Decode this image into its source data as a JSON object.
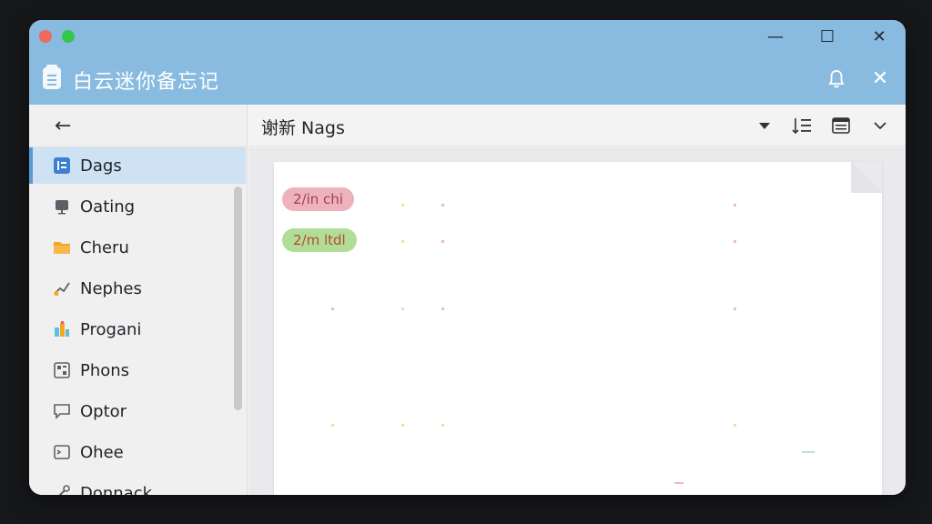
{
  "app": {
    "title": "白云迷你备忘记"
  },
  "window_controls": {
    "minimize": "—",
    "maximize": "☐",
    "close": "✕"
  },
  "sidebar": {
    "items": [
      {
        "label": "Dags",
        "icon": "list-icon",
        "active": true
      },
      {
        "label": "Oating",
        "icon": "monitor-icon"
      },
      {
        "label": "Cheru",
        "icon": "folder-icon"
      },
      {
        "label": "Nephes",
        "icon": "chart-icon"
      },
      {
        "label": "Progani",
        "icon": "bars-icon"
      },
      {
        "label": "Phons",
        "icon": "grid-icon"
      },
      {
        "label": "Optor",
        "icon": "chat-icon"
      },
      {
        "label": "Ohee",
        "icon": "terminal-icon"
      },
      {
        "label": "Donnack",
        "icon": "tool-icon"
      }
    ]
  },
  "toolbar": {
    "title": "谢新 Nags"
  },
  "note": {
    "tags": [
      {
        "label": "2/in chi",
        "color": "#eeb2bc"
      },
      {
        "label": "2/m ltdl",
        "color": "#b2dd97"
      }
    ]
  },
  "colors": {
    "titlebar": "#88bbdf",
    "active_item": "#cfe2f3",
    "accent": "#5b9bd5"
  }
}
